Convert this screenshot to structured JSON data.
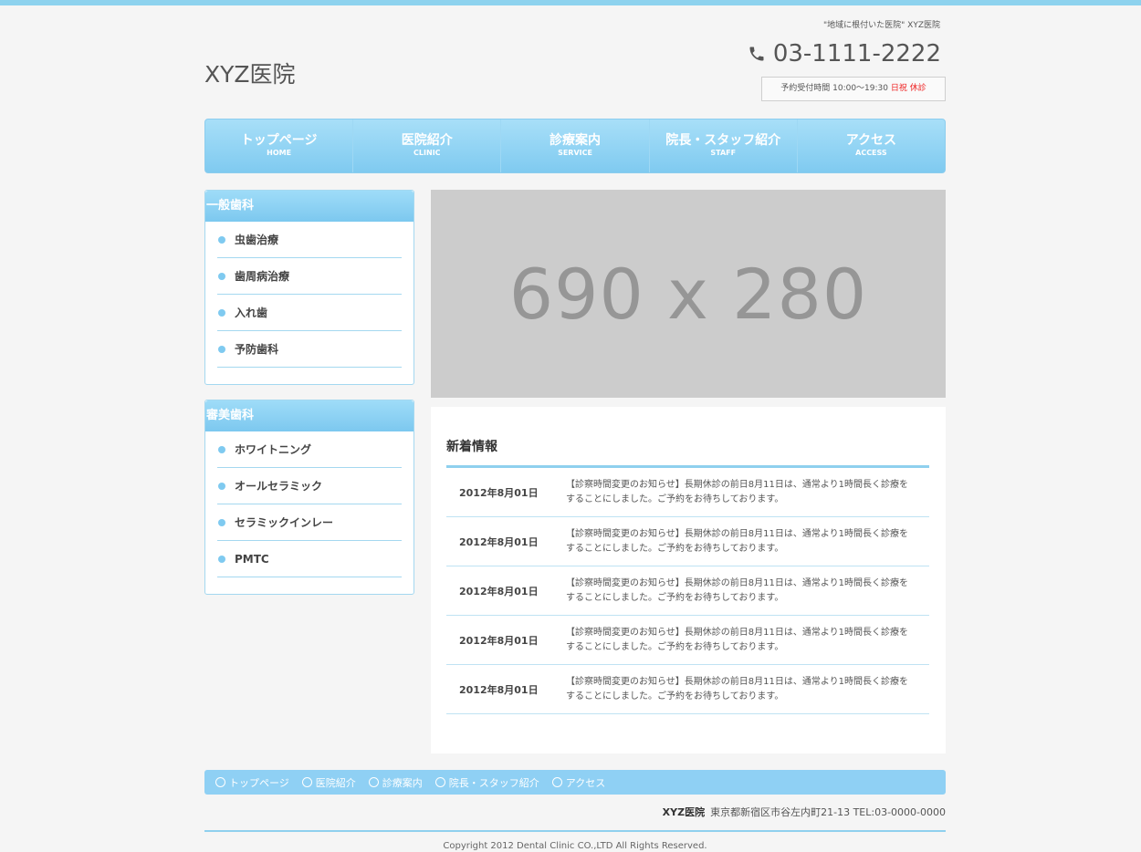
{
  "header": {
    "tagline": "\"地域に根付いた医院\" XYZ医院",
    "logo": "XYZ医院",
    "phone": "03-1111-2222",
    "hours_label": "予約受付時間 10:00〜19:30",
    "hours_closed": "日祝 休診"
  },
  "global_nav": [
    {
      "jp": "トップページ",
      "en": "HOME"
    },
    {
      "jp": "医院紹介",
      "en": "CLINIC"
    },
    {
      "jp": "診療案内",
      "en": "SERVICE"
    },
    {
      "jp": "院長・スタッフ紹介",
      "en": "STAFF"
    },
    {
      "jp": "アクセス",
      "en": "ACCESS"
    }
  ],
  "sidebar": {
    "general": {
      "title": "一般歯科",
      "items": [
        "虫歯治療",
        "歯周病治療",
        "入れ歯",
        "予防歯科"
      ]
    },
    "cosmetic": {
      "title": "審美歯科",
      "items": [
        "ホワイトニング",
        "オールセラミック",
        "セラミックインレー",
        "PMTC"
      ]
    }
  },
  "hero": {
    "placeholder": "690 x 280"
  },
  "news": {
    "title": "新着情報",
    "items": [
      {
        "date": "2012年8月01日",
        "text": "【診察時間変更のお知らせ】長期休診の前日8月11日は、通常より1時間長く診療をすることにしました。ご予約をお待ちしております。"
      },
      {
        "date": "2012年8月01日",
        "text": "【診察時間変更のお知らせ】長期休診の前日8月11日は、通常より1時間長く診療をすることにしました。ご予約をお待ちしております。"
      },
      {
        "date": "2012年8月01日",
        "text": "【診察時間変更のお知らせ】長期休診の前日8月11日は、通常より1時間長く診療をすることにしました。ご予約をお待ちしております。"
      },
      {
        "date": "2012年8月01日",
        "text": "【診察時間変更のお知らせ】長期休診の前日8月11日は、通常より1時間長く診療をすることにしました。ご予約をお待ちしております。"
      },
      {
        "date": "2012年8月01日",
        "text": "【診察時間変更のお知らせ】長期休診の前日8月11日は、通常より1時間長く診療をすることにしました。ご予約をお待ちしております。"
      }
    ]
  },
  "footer": {
    "nav": [
      "トップページ",
      "医院紹介",
      "診療案内",
      "院長・スタッフ紹介",
      "アクセス"
    ],
    "clinic_name": "XYZ医院",
    "address": "東京都新宿区市谷左内町21-13 TEL:03-0000-0000",
    "copyright": "Copyright 2012 Dental Clinic CO.,LTD All Rights Reserved."
  },
  "colors": {
    "accent": "#8dd2ee",
    "closed_red": "#ee2222",
    "placeholder_bg": "#cccccc"
  },
  "icons": {
    "phone": "phone-icon",
    "bullet": "bullet-dot-icon",
    "footer_bullet": "circle-icon"
  }
}
